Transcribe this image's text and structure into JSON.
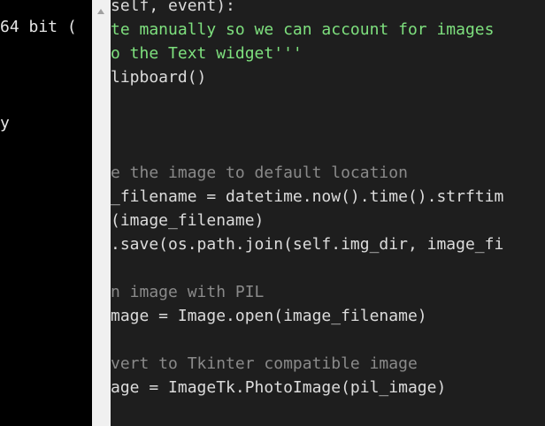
{
  "left_panel": {
    "lines": [
      "64 bit (",
      "y"
    ]
  },
  "code": {
    "lines": [
      {
        "text": "self, event):",
        "kind": "normal"
      },
      {
        "text": "te manually so we can account for images",
        "kind": "string"
      },
      {
        "text": "o the Text widget'''",
        "kind": "string"
      },
      {
        "text": "lipboard()",
        "kind": "normal"
      },
      {
        "text": "e the image to default location",
        "kind": "comment"
      },
      {
        "text": "_filename = datetime.now().time().strftim",
        "kind": "normal"
      },
      {
        "text": "(image_filename)",
        "kind": "normal"
      },
      {
        "text": ".save(os.path.join(self.img_dir, image_fi",
        "kind": "normal"
      },
      {
        "text": "n image with PIL",
        "kind": "comment"
      },
      {
        "text": "mage = Image.open(image_filename)",
        "kind": "normal"
      },
      {
        "text": "vert to Tkinter compatible image",
        "kind": "comment"
      },
      {
        "text": "age = ImageTk.PhotoImage(pil_image)",
        "kind": "normal"
      }
    ]
  },
  "colors": {
    "background": "#1e1e1e",
    "left_panel": "#000000",
    "divider": "#f0f0f0",
    "code_text": "#dcdcdc",
    "string": "#7ee07e",
    "comment": "#8a8a8a"
  },
  "icons": {
    "scroll_up": "scroll-up-arrow-icon"
  }
}
